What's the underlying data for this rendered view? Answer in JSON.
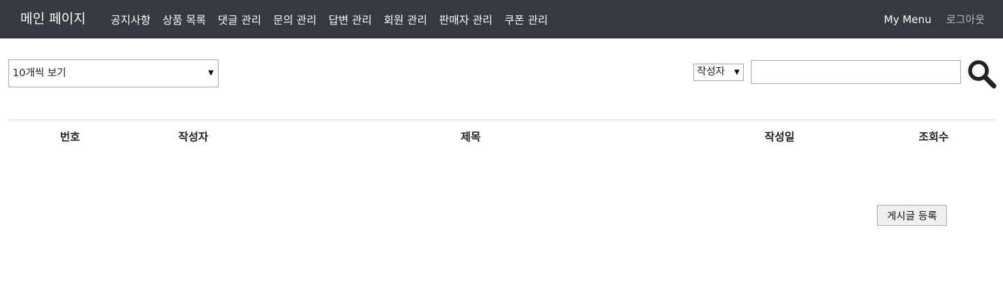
{
  "navbar": {
    "brand": "메인 페이지",
    "items": [
      {
        "label": "공지사항"
      },
      {
        "label": "상품 목록"
      },
      {
        "label": "댓글 관리"
      },
      {
        "label": "문의 관리"
      },
      {
        "label": "답변 관리"
      },
      {
        "label": "회원 관리"
      },
      {
        "label": "판매자 관리"
      },
      {
        "label": "쿠폰 관리"
      }
    ],
    "my_menu": "My Menu",
    "logout": "로그아웃"
  },
  "filters": {
    "page_size_selected": "10개씩 보기",
    "search_field_selected": "작성자",
    "search_value": "",
    "search_icon": "search-icon"
  },
  "table": {
    "columns": [
      "번호",
      "작성자",
      "제목",
      "작성일",
      "조회수"
    ]
  },
  "actions": {
    "write_label": "게시글 등록"
  }
}
